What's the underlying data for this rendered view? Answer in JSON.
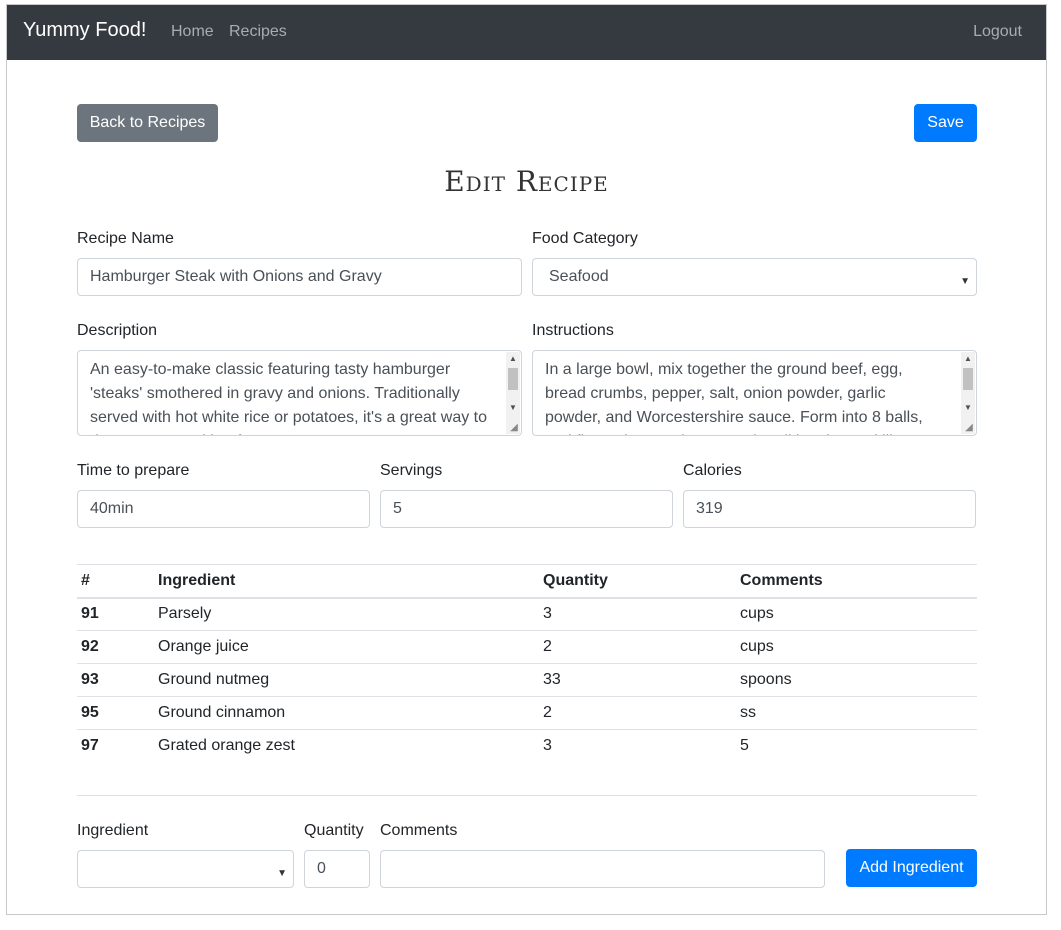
{
  "navbar": {
    "brand": "Yummy Food!",
    "home": "Home",
    "recipes": "Recipes",
    "logout": "Logout"
  },
  "toolbar": {
    "back_label": "Back to Recipes",
    "save_label": "Save"
  },
  "page_title": "Edit Recipe",
  "form": {
    "recipe_name_label": "Recipe Name",
    "recipe_name_value": "Hamburger Steak with Onions and Gravy",
    "food_category_label": "Food Category",
    "food_category_value": "Seafood",
    "description_label": "Description",
    "description_value": "An easy-to-make classic featuring tasty hamburger 'steaks' smothered in gravy and onions. Traditionally served with hot white rice or potatoes, it's a great way to dress up ground beef ...",
    "instructions_label": "Instructions",
    "instructions_value": "In a large bowl, mix together the ground beef, egg, bread crumbs, pepper, salt, onion powder, garlic powder, and Worcestershire sauce. Form into 8 balls, and flatten into patties. Heat the oil in a large skillet over medium heat ...",
    "time_label": "Time to prepare",
    "time_value": "40min",
    "servings_label": "Servings",
    "servings_value": "5",
    "calories_label": "Calories",
    "calories_value": "319"
  },
  "ingredients_table": {
    "headers": [
      "#",
      "Ingredient",
      "Quantity",
      "Comments"
    ],
    "rows": [
      {
        "id": "91",
        "ingredient": "Parsely",
        "quantity": "3",
        "comments": "cups"
      },
      {
        "id": "92",
        "ingredient": "Orange juice",
        "quantity": "2",
        "comments": "cups"
      },
      {
        "id": "93",
        "ingredient": "Ground nutmeg",
        "quantity": "33",
        "comments": "spoons"
      },
      {
        "id": "95",
        "ingredient": "Ground cinnamon",
        "quantity": "2",
        "comments": "ss"
      },
      {
        "id": "97",
        "ingredient": "Grated orange zest",
        "quantity": "3",
        "comments": "5"
      }
    ]
  },
  "add_form": {
    "ingredient_label": "Ingredient",
    "ingredient_value": "",
    "quantity_label": "Quantity",
    "quantity_value": "0",
    "comments_label": "Comments",
    "comments_value": "",
    "add_label": "Add Ingredient"
  },
  "colors": {
    "navbar_bg": "#343a40",
    "primary": "#007bff",
    "secondary": "#6c757d"
  }
}
